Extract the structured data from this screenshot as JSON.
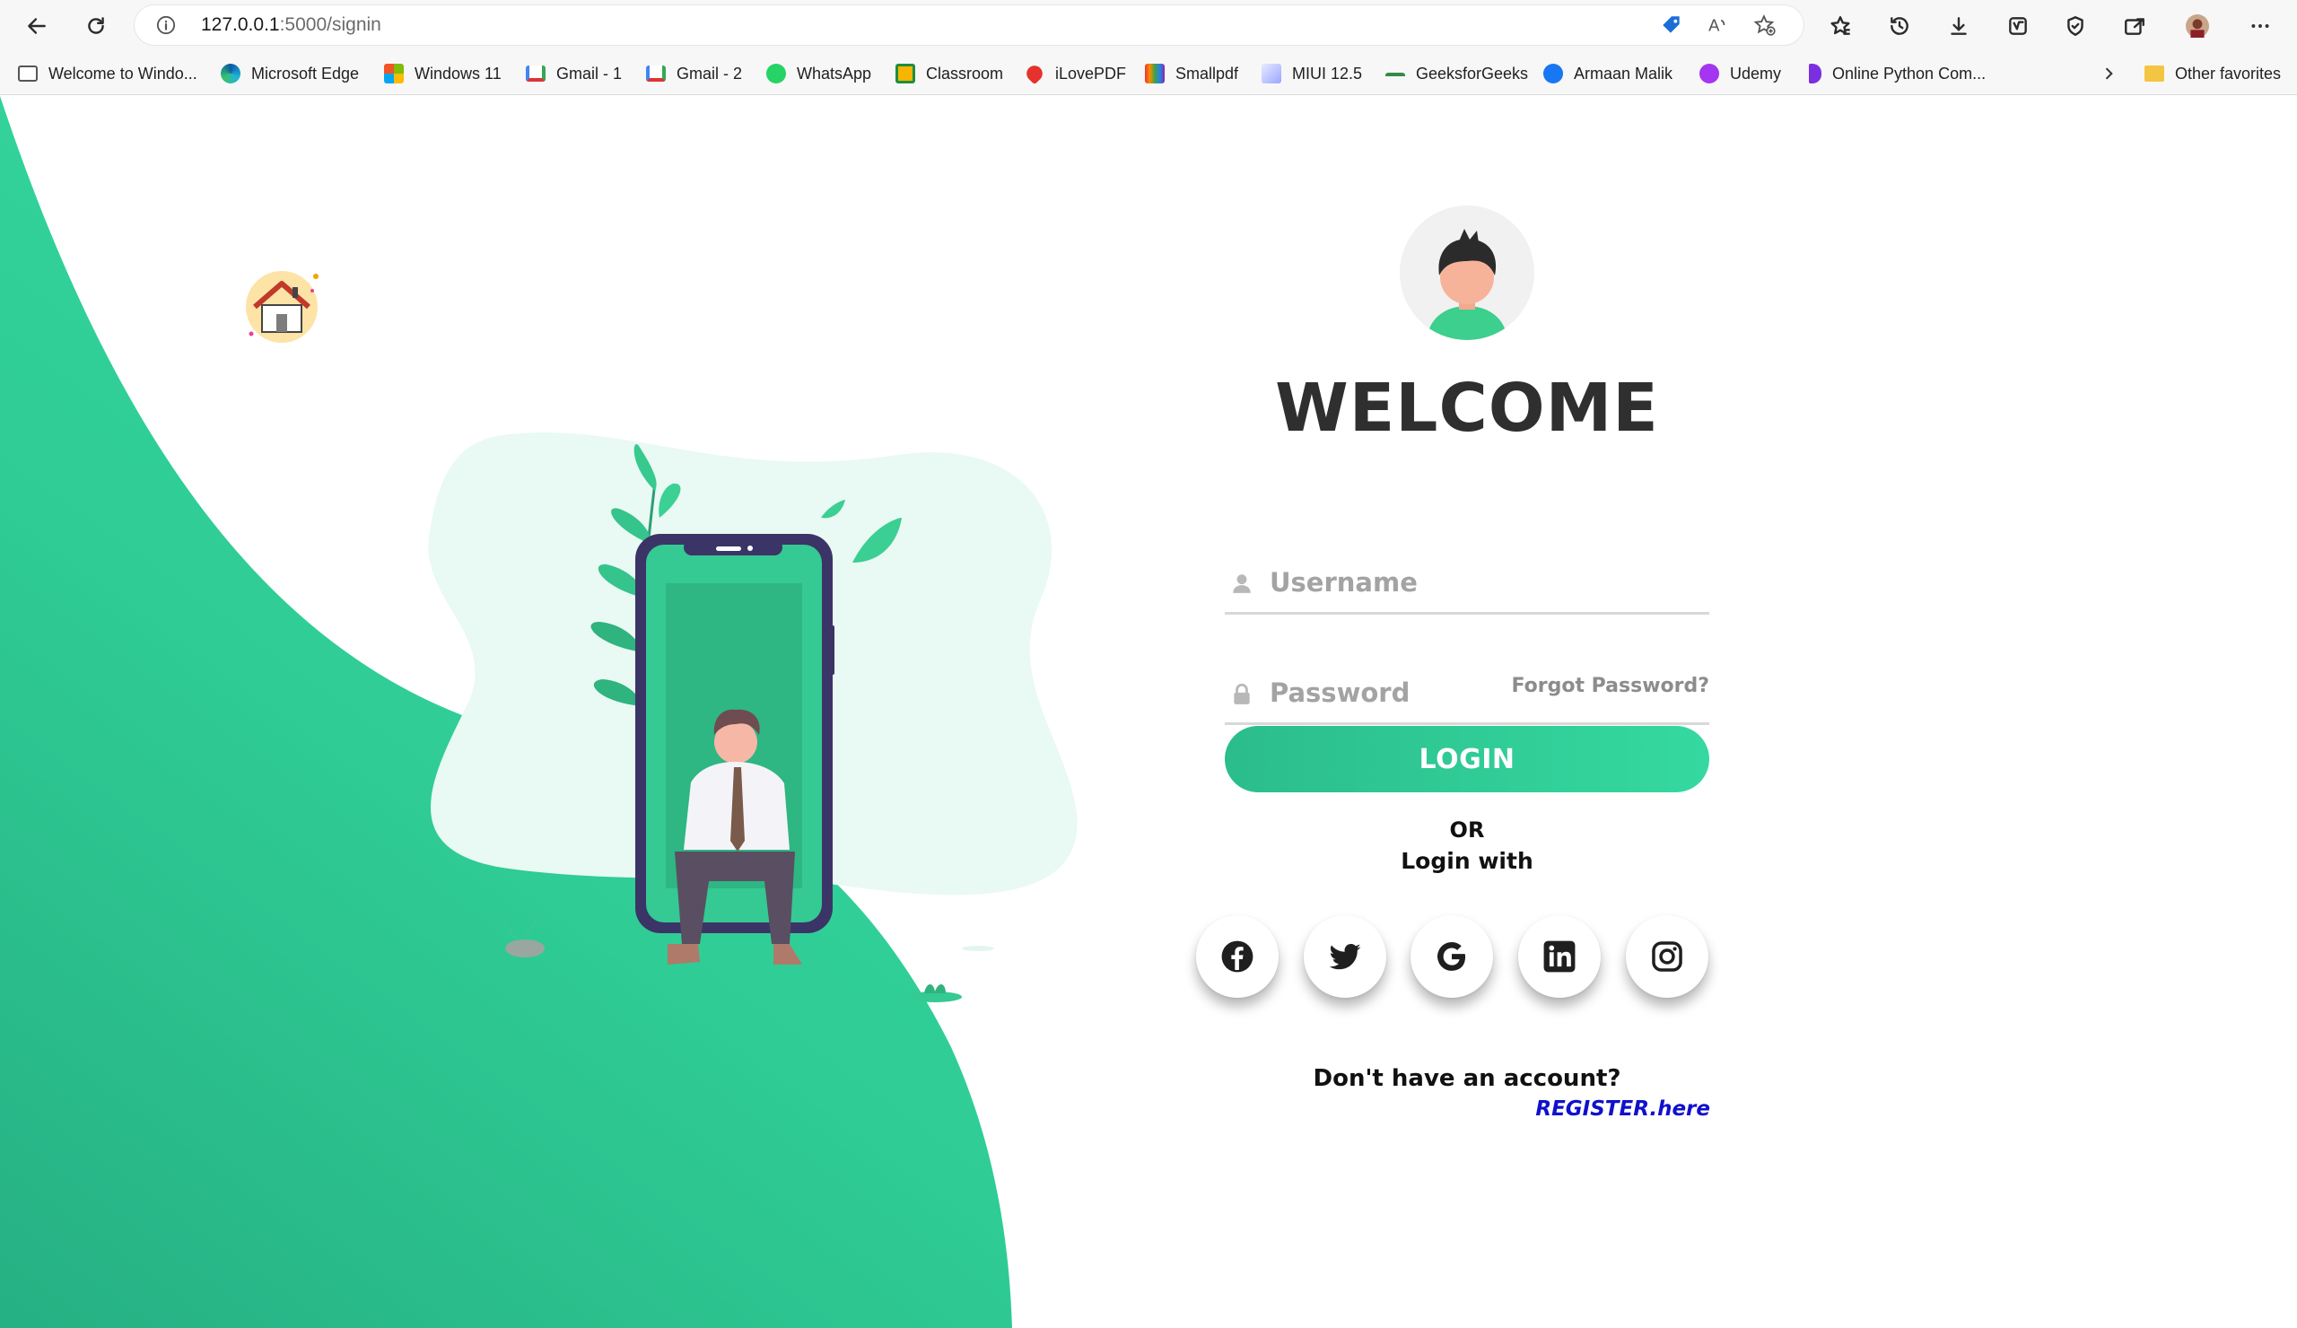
{
  "browser": {
    "url_host": "127.0.0.1",
    "url_path": ":5000/signin",
    "bookmarks": [
      {
        "label": "Welcome to Windo...",
        "icon": "page-icon"
      },
      {
        "label": "Microsoft Edge",
        "icon": "edge-icon"
      },
      {
        "label": "Windows 11",
        "icon": "windows-icon"
      },
      {
        "label": "Gmail - 1",
        "icon": "gmail-icon"
      },
      {
        "label": "Gmail - 2",
        "icon": "gmail-icon"
      },
      {
        "label": "WhatsApp",
        "icon": "whatsapp-icon"
      },
      {
        "label": "Classroom",
        "icon": "classroom-icon"
      },
      {
        "label": "iLovePDF",
        "icon": "ilovepdf-icon"
      },
      {
        "label": "Smallpdf",
        "icon": "smallpdf-icon"
      },
      {
        "label": "MIUI 12.5",
        "icon": "miui-icon"
      },
      {
        "label": "GeeksforGeeks",
        "icon": "gfg-icon"
      },
      {
        "label": "Armaan Malik",
        "icon": "facebook-icon"
      },
      {
        "label": "Udemy",
        "icon": "udemy-icon"
      },
      {
        "label": "Online Python Com...",
        "icon": "python-icon"
      }
    ],
    "other_favorites": "Other favorites"
  },
  "signin": {
    "title": "WELCOME",
    "username_placeholder": "Username",
    "password_placeholder": "Password",
    "forgot": "Forgot Password?",
    "login_label": "LOGIN",
    "or": "OR",
    "login_with": "Login with",
    "social": [
      "facebook",
      "twitter",
      "google",
      "linkedin",
      "instagram"
    ],
    "no_account": "Don't have an account?",
    "register": "REGISTER.here"
  },
  "colors": {
    "accent": "#32cf97",
    "accent_dark": "#2bb386",
    "register_link": "#1010cc",
    "phone_frame": "#3b3466"
  }
}
